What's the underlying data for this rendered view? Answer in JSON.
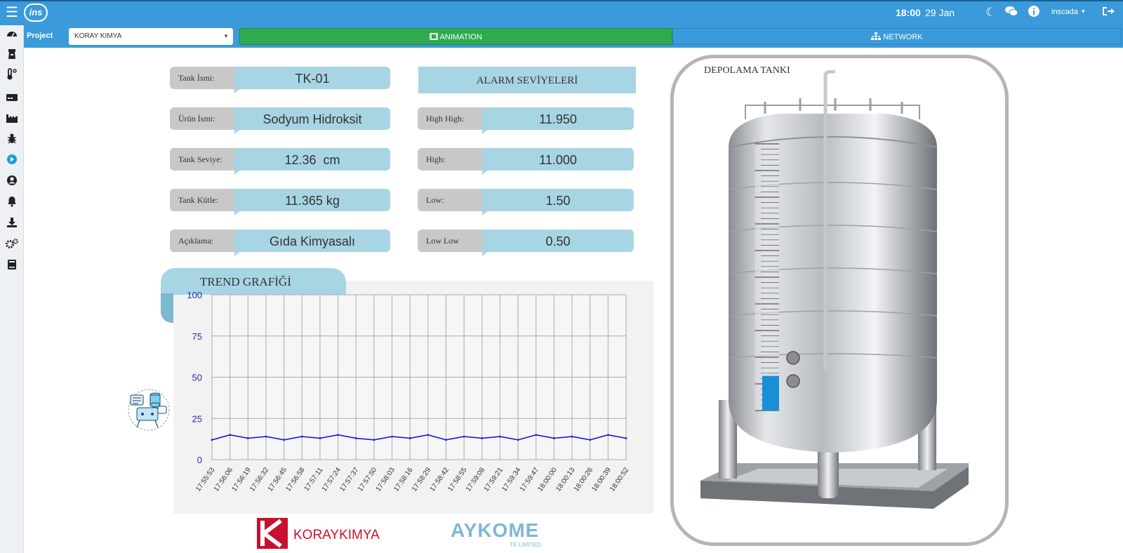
{
  "topbar": {
    "logo_text": "ins",
    "time": "18:00",
    "date": "29 Jan",
    "user": "inscada"
  },
  "project": {
    "label": "Project",
    "selected": "KORAY KIMYA",
    "tabs": [
      {
        "label": "ANIMATION",
        "color": "#2eab4f",
        "active": true
      },
      {
        "label": "NETWORK",
        "color": "#3b9ad9",
        "active": false
      }
    ]
  },
  "sidebar": {
    "items": [
      "dashboard-icon",
      "tower-icon",
      "temperature-icon",
      "device-icon",
      "factory-icon",
      "bug-icon",
      "animation-icon",
      "user-icon",
      "bell-icon",
      "download-icon",
      "gears-icon",
      "book-icon"
    ]
  },
  "tank_info": [
    {
      "label": "Tank İsmi:",
      "value": "TK-01"
    },
    {
      "label": "Ürün İsmi:",
      "value": "Sodyum Hidroksit"
    },
    {
      "label": "Tank Seviye:",
      "value": "12.36  cm"
    },
    {
      "label": "Tank Kütle:",
      "value": "11.365 kg"
    },
    {
      "label": "Açıklama:",
      "value": "Gıda Kimyasalı"
    }
  ],
  "alarms": {
    "title": "ALARM SEVİYELERİ",
    "items": [
      {
        "label": "High High:",
        "value": "11.950"
      },
      {
        "label": "High:",
        "value": "11.000"
      },
      {
        "label": "Low:",
        "value": "1.50"
      },
      {
        "label": "Low Low",
        "value": "0.50"
      }
    ]
  },
  "trend": {
    "title": "TREND GRAFİĞİ"
  },
  "chart_data": {
    "type": "line",
    "title": "TREND GRAFİĞİ",
    "ylim": [
      0,
      100
    ],
    "yticks": [
      0,
      25,
      50,
      75,
      100
    ],
    "x": [
      "17:55:53",
      "17:56:06",
      "17:56:19",
      "17:56:32",
      "17:56:45",
      "17:56:58",
      "17:57:11",
      "17:57:24",
      "17:57:37",
      "17:57:50",
      "17:58:03",
      "17:58:16",
      "17:58:29",
      "17:58:42",
      "17:58:55",
      "17:59:08",
      "17:59:21",
      "17:59:34",
      "17:59:47",
      "18:00:00",
      "18:00:13",
      "18:00:26",
      "18:00:39",
      "18:00:52"
    ],
    "series": [
      {
        "color": "#1a1adb",
        "values": [
          12,
          15,
          13,
          14,
          12,
          14,
          13,
          15,
          13,
          12,
          14,
          13,
          15,
          12,
          14,
          13,
          14,
          12,
          15,
          13,
          14,
          12,
          15,
          13
        ]
      }
    ],
    "grid": true
  },
  "tank_panel": {
    "title": "DEPOLAMA TANKI",
    "level_fraction": 0.13
  },
  "logos": {
    "koray": "KORAYKIMYA",
    "aykome": "AYKOME",
    "aykome_sub": "TR LIMITED"
  },
  "colors": {
    "accent": "#3b9ad9",
    "green": "#2eab4f",
    "field_value": "#a8d5e3",
    "field_label": "#c8c8c8",
    "tank_level": "#1a8fd6"
  }
}
